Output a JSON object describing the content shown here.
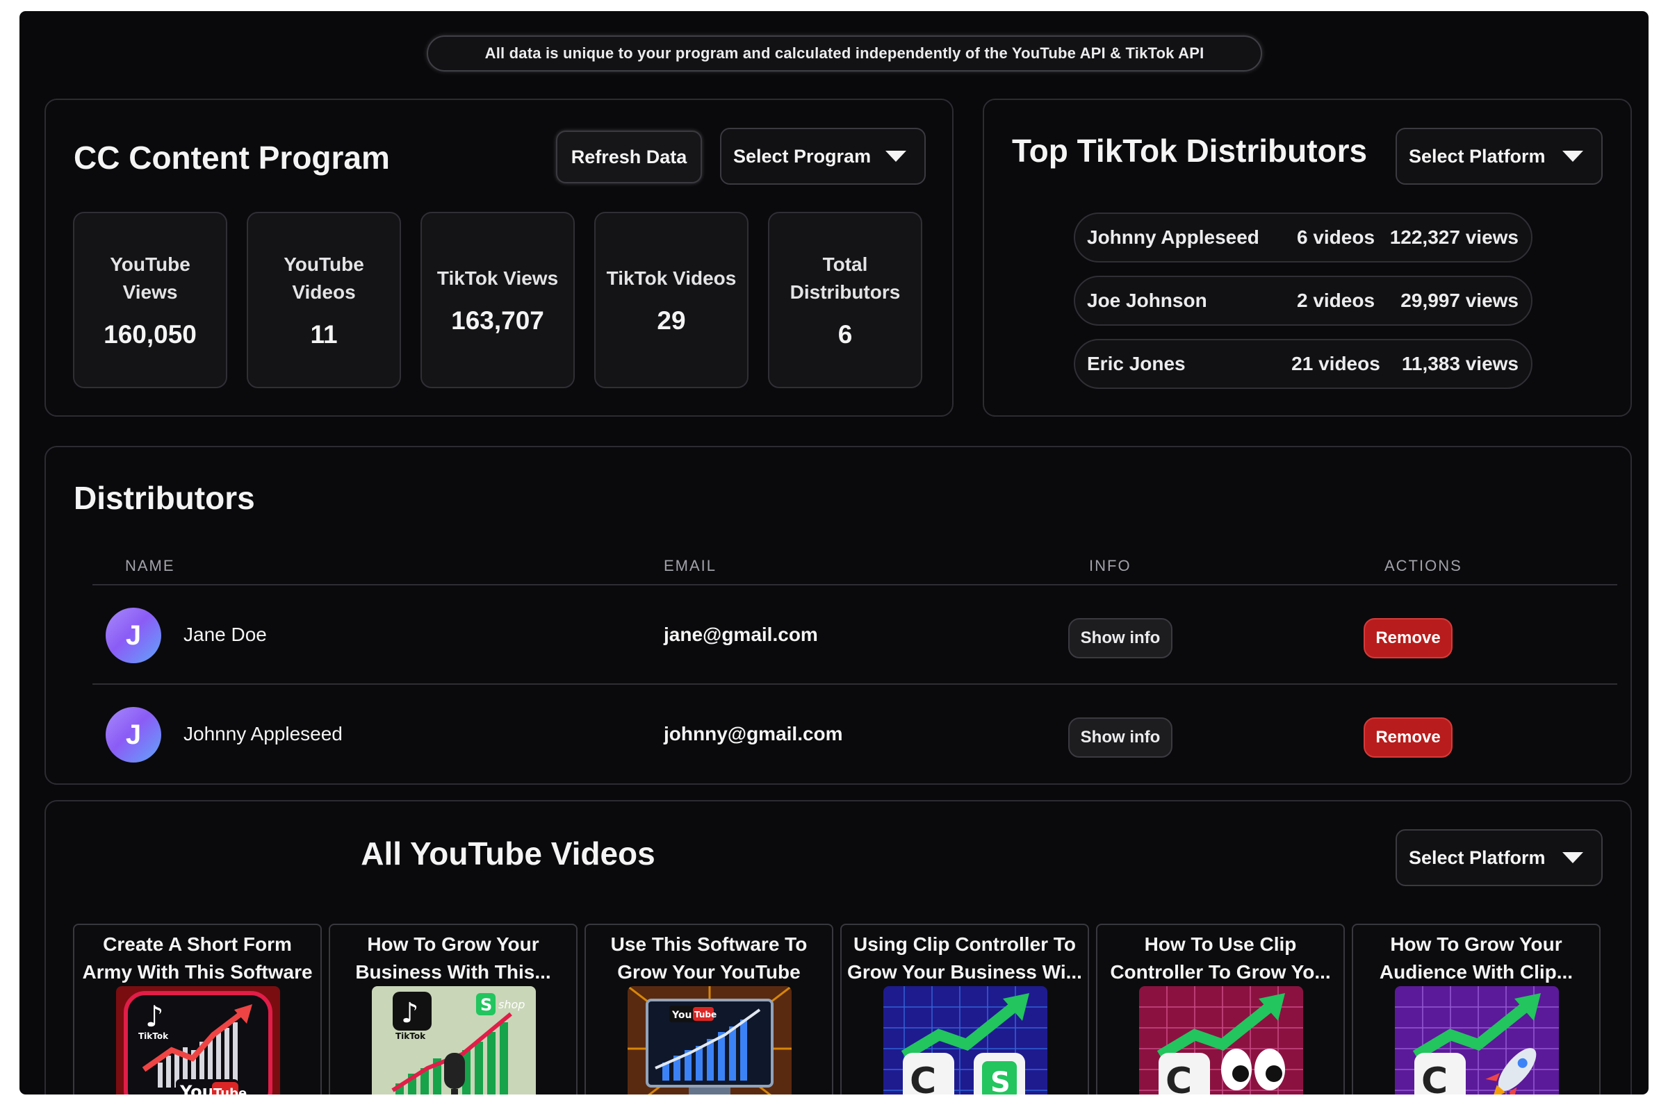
{
  "notice": "All data is unique to your program and calculated independently of the YouTube API & TikTok API",
  "program": {
    "title": "CC Content Program",
    "refresh_label": "Refresh Data",
    "select_label": "Select Program",
    "stats": [
      {
        "label": "YouTube Views",
        "value": "160,050"
      },
      {
        "label": "YouTube Videos",
        "value": "11"
      },
      {
        "label": "TikTok Views",
        "value": "163,707"
      },
      {
        "label": "TikTok Videos",
        "value": "29"
      },
      {
        "label": "Total Distributors",
        "value": "6"
      }
    ]
  },
  "top_distributors": {
    "title": "Top TikTok Distributors",
    "select_label": "Select Platform",
    "rows": [
      {
        "name": "Johnny Appleseed",
        "videos": "6 videos",
        "views": "122,327 views"
      },
      {
        "name": "Joe Johnson",
        "videos": "2 videos",
        "views": "29,997 views"
      },
      {
        "name": "Eric Jones",
        "videos": "21 videos",
        "views": "11,383 views"
      }
    ]
  },
  "distributors": {
    "title": "Distributors",
    "columns": [
      "NAME",
      "EMAIL",
      "INFO",
      "ACTIONS"
    ],
    "rows": [
      {
        "initial": "J",
        "name": "Jane Doe",
        "email": "jane@gmail.com",
        "info_label": "Show info",
        "remove_label": "Remove"
      },
      {
        "initial": "J",
        "name": "Johnny Appleseed",
        "email": "johnny@gmail.com",
        "info_label": "Show info",
        "remove_label": "Remove"
      }
    ]
  },
  "youtube_videos": {
    "title": "All YouTube Videos",
    "select_label": "Select Platform",
    "videos": [
      {
        "line1": "Create A Short Form",
        "line2": "Army With This Software",
        "thumb": "tiktok-youtube-growth"
      },
      {
        "line1": "How To Grow Your",
        "line2": "Business With This...",
        "thumb": "tiktok-shopify-growth"
      },
      {
        "line1": "Use This Software To",
        "line2": "Grow Your YouTube",
        "thumb": "youtube-monitor-growth"
      },
      {
        "line1": "Using Clip Controller To",
        "line2": "Grow Your Business Wi...",
        "thumb": "clip-controller-shopify"
      },
      {
        "line1": "How To Use Clip",
        "line2": "Controller To Grow Yo...",
        "thumb": "clip-controller-eyes"
      },
      {
        "line1": "How To Grow Your",
        "line2": "Audience With Clip...",
        "thumb": "clip-controller-rocket"
      }
    ]
  },
  "colors": {
    "background": "#09090b",
    "remove": "#b91c1c",
    "avatar_start": "#a78bfa",
    "avatar_end": "#60a5fa",
    "growth_arrow": "#22c55e"
  }
}
